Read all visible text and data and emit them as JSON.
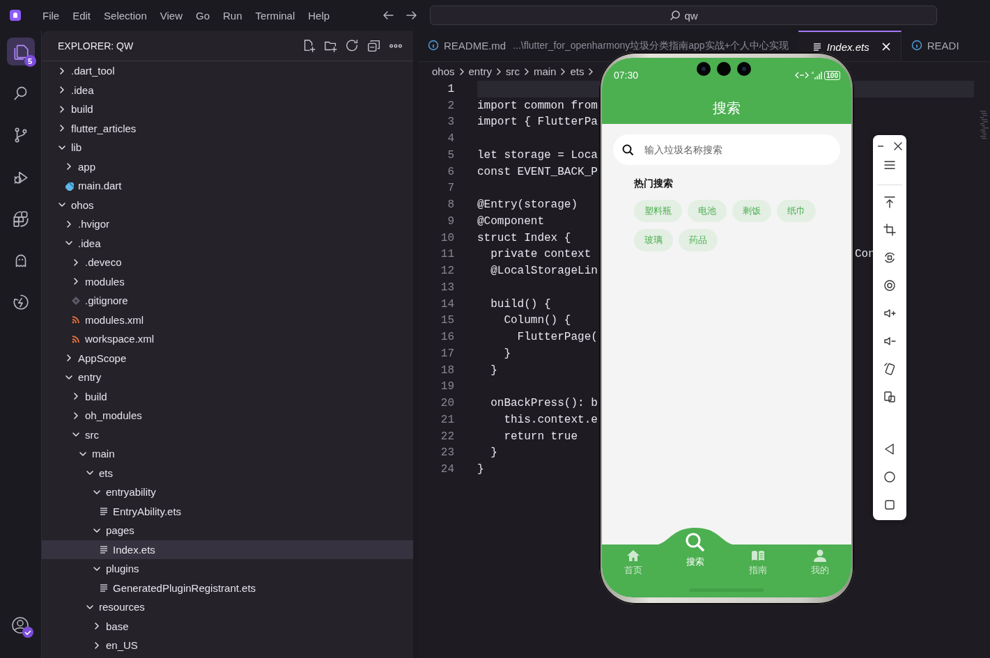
{
  "title_bar": {
    "menu": [
      "File",
      "Edit",
      "Selection",
      "View",
      "Go",
      "Run",
      "Terminal",
      "Help"
    ],
    "command_center": {
      "label": "qw"
    }
  },
  "activity_bar": {
    "items": [
      {
        "selected": true,
        "badge": "5"
      },
      {
        "selected": false
      },
      {
        "selected": false
      },
      {
        "selected": false
      },
      {
        "selected": false
      },
      {
        "selected": false
      },
      {
        "selected": false
      }
    ]
  },
  "explorer": {
    "title": "EXPLORER: QW",
    "tree": [
      {
        "name": ".dart_tool",
        "kind": "folder",
        "expanded": false,
        "selected": false
      },
      {
        "name": ".idea",
        "kind": "folder",
        "expanded": false,
        "selected": false
      },
      {
        "name": "build",
        "kind": "folder",
        "expanded": false,
        "selected": false
      },
      {
        "name": "flutter_articles",
        "kind": "folder",
        "expanded": false,
        "selected": false
      },
      {
        "name": "lib",
        "kind": "folder",
        "expanded": true,
        "selected": false,
        "children": [
          {
            "name": "app",
            "kind": "folder",
            "expanded": false,
            "selected": false
          },
          {
            "name": "main.dart",
            "kind": "dart",
            "selected": false
          }
        ]
      },
      {
        "name": "ohos",
        "kind": "folder",
        "expanded": true,
        "selected": false,
        "children": [
          {
            "name": ".hvigor",
            "kind": "folder",
            "expanded": false,
            "selected": false
          },
          {
            "name": ".idea",
            "kind": "folder",
            "expanded": true,
            "selected": false,
            "children": [
              {
                "name": ".deveco",
                "kind": "folder",
                "expanded": false,
                "selected": false
              },
              {
                "name": "modules",
                "kind": "folder",
                "expanded": false,
                "selected": false
              },
              {
                "name": ".gitignore",
                "kind": "git",
                "selected": false
              },
              {
                "name": "modules.xml",
                "kind": "xml",
                "selected": false
              },
              {
                "name": "workspace.xml",
                "kind": "xml",
                "selected": false
              }
            ]
          },
          {
            "name": "AppScope",
            "kind": "folder",
            "expanded": false,
            "selected": false
          },
          {
            "name": "entry",
            "kind": "folder",
            "expanded": true,
            "selected": false,
            "children": [
              {
                "name": "build",
                "kind": "folder",
                "expanded": false,
                "selected": false
              },
              {
                "name": "oh_modules",
                "kind": "folder",
                "expanded": false,
                "selected": false
              },
              {
                "name": "src",
                "kind": "folder",
                "expanded": true,
                "selected": false,
                "children": [
                  {
                    "name": "main",
                    "kind": "folder",
                    "expanded": true,
                    "selected": false,
                    "children": [
                      {
                        "name": "ets",
                        "kind": "folder",
                        "expanded": true,
                        "selected": false,
                        "children": [
                          {
                            "name": "entryability",
                            "kind": "folder",
                            "expanded": true,
                            "selected": false,
                            "children": [
                              {
                                "name": "EntryAbility.ets",
                                "kind": "ets",
                                "selected": false
                              }
                            ]
                          },
                          {
                            "name": "pages",
                            "kind": "folder",
                            "expanded": true,
                            "selected": false,
                            "children": [
                              {
                                "name": "Index.ets",
                                "kind": "ets",
                                "selected": true
                              }
                            ]
                          },
                          {
                            "name": "plugins",
                            "kind": "folder",
                            "expanded": true,
                            "selected": false,
                            "children": [
                              {
                                "name": "GeneratedPluginRegistrant.ets",
                                "kind": "ets",
                                "selected": false
                              }
                            ]
                          }
                        ]
                      },
                      {
                        "name": "resources",
                        "kind": "folder",
                        "expanded": true,
                        "selected": false,
                        "children": [
                          {
                            "name": "base",
                            "kind": "folder",
                            "expanded": false,
                            "selected": false
                          },
                          {
                            "name": "en_US",
                            "kind": "folder",
                            "expanded": false,
                            "selected": false
                          }
                        ]
                      }
                    ]
                  }
                ]
              }
            ]
          }
        ]
      }
    ]
  },
  "editor": {
    "tabs": [
      {
        "label": "README.md",
        "description": "...\\flutter_for_openharmony垃圾分类指南app实战+个人中心实现",
        "kind": "info",
        "selected": false
      },
      {
        "label": "Index.ets",
        "kind": "ets",
        "selected": true
      },
      {
        "label": "READI",
        "kind": "info",
        "selected": false
      }
    ],
    "breadcrumb": [
      "ohos",
      "entry",
      "src",
      "main",
      "ets"
    ],
    "lines": [
      {
        "number": "1"
      },
      {
        "number": "2",
        "text": "import common from"
      },
      {
        "number": "3",
        "text": "import { FlutterPa"
      },
      {
        "number": "4"
      },
      {
        "number": "5",
        "text": "let storage = Loca"
      },
      {
        "number": "6",
        "text": "const EVENT_BACK_P"
      },
      {
        "number": "7"
      },
      {
        "number": "8",
        "text": "@Entry(storage)"
      },
      {
        "number": "9",
        "text": "@Component"
      },
      {
        "number": "10",
        "text": "struct Index {"
      },
      {
        "number": "11",
        "text": "  private context",
        "tail": "Con"
      },
      {
        "number": "12",
        "text": "  @LocalStorageLin"
      },
      {
        "number": "13"
      },
      {
        "number": "14",
        "text": "  build() {"
      },
      {
        "number": "15",
        "text": "    Column() {"
      },
      {
        "number": "16",
        "text": "      FlutterPage("
      },
      {
        "number": "17",
        "text": "    }"
      },
      {
        "number": "18",
        "text": "  }"
      },
      {
        "number": "19"
      },
      {
        "number": "20",
        "text": "  onBackPress(): b"
      },
      {
        "number": "21",
        "text": "    this.context.e"
      },
      {
        "number": "22",
        "text": "    return true"
      },
      {
        "number": "23",
        "text": "  }"
      },
      {
        "number": "24",
        "text": "}"
      }
    ]
  },
  "phone": {
    "status_bar": {
      "time": "07:30",
      "battery": "100"
    },
    "title": "搜索",
    "search": {
      "placeholder": "输入垃圾名称搜索"
    },
    "hot_title": "热门搜索",
    "chips": [
      "塑料瓶",
      "电池",
      "剩饭",
      "纸巾",
      "玻璃",
      "药品"
    ],
    "nav": [
      {
        "label": "首页",
        "selected": false
      },
      {
        "label": "搜索",
        "selected": true
      },
      {
        "label": "指南",
        "selected": false
      },
      {
        "label": "我的",
        "selected": false
      }
    ]
  }
}
